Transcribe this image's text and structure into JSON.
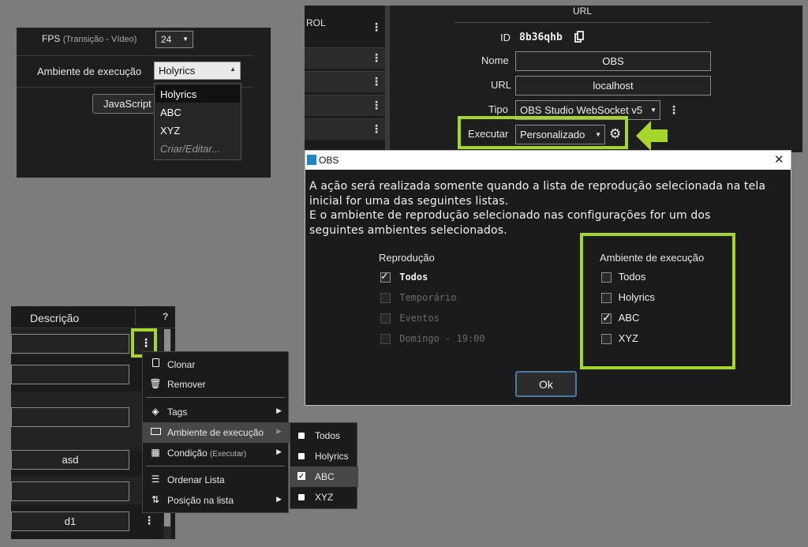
{
  "fps_panel": {
    "fps_label": "FPS",
    "fps_hint": "(Transição - Vídeo)",
    "fps_value": "24",
    "env_label": "Ambiente de execução",
    "env_value": "Holyrics",
    "javascript_button": "JavaScript",
    "dropdown_options": [
      "Holyrics",
      "ABC",
      "XYZ",
      "Criar/Editar..."
    ]
  },
  "list_panel": {
    "header_description": "Descrição",
    "header_help": "?",
    "rows": [
      "",
      "",
      "",
      "",
      "asd",
      "",
      "d1"
    ]
  },
  "context_menu": {
    "items": [
      {
        "label": "Clonar",
        "icon": "clone-icon"
      },
      {
        "label": "Remover",
        "icon": "trash-icon"
      },
      {
        "label": "Tags",
        "icon": "tag-icon"
      },
      {
        "label": "Ambiente de execução",
        "icon": "monitor-icon"
      },
      {
        "label": "Condição",
        "hint": "(Executar)",
        "icon": "calendar-check-icon"
      },
      {
        "label": "Ordenar Lista",
        "icon": "list-icon"
      },
      {
        "label": "Posição na lista",
        "icon": "sort-arrows-icon"
      }
    ],
    "submenu": [
      {
        "label": "Todos",
        "checked": false
      },
      {
        "label": "Holyrics",
        "checked": false
      },
      {
        "label": "ABC",
        "checked": true
      },
      {
        "label": "XYZ",
        "checked": false
      }
    ]
  },
  "settings_panel": {
    "side_label": "ROL",
    "url_header": "URL",
    "id_label": "ID",
    "id_value": "8b36qhb",
    "nome_label": "Nome",
    "nome_value": "OBS",
    "url_label": "URL",
    "url_value": "localhost",
    "tipo_label": "Tipo",
    "tipo_value": "OBS Studio WebSocket v5",
    "executar_label": "Executar",
    "executar_value": "Personalizado"
  },
  "dialog": {
    "title": "OBS",
    "close": "✕",
    "message_line1": "A ação será realizada somente quando a lista de reprodução selecionada na tela",
    "message_line2": "inicial for uma das seguintes listas.",
    "message_line3": "E o ambiente de reprodução selecionado nas configurações for um dos",
    "message_line4": "seguintes ambientes selecionados.",
    "reproducao_title": "Reprodução",
    "reproducao_items": [
      {
        "label": "Todos",
        "checked": true,
        "enabled": true
      },
      {
        "label": "Temporário",
        "checked": false,
        "enabled": false
      },
      {
        "label": "Eventos",
        "checked": false,
        "enabled": false
      },
      {
        "label": "Domingo - 19:00",
        "checked": false,
        "enabled": false
      }
    ],
    "ambiente_title": "Ambiente de execução",
    "ambiente_items": [
      {
        "label": "Todos",
        "checked": false
      },
      {
        "label": "Holyrics",
        "checked": false
      },
      {
        "label": "ABC",
        "checked": true
      },
      {
        "label": "XYZ",
        "checked": false
      }
    ],
    "ok_label": "Ok"
  },
  "colors": {
    "highlight_green": "#a6d62b",
    "background": "#7c7c7c",
    "panel": "#1e1e1e"
  }
}
